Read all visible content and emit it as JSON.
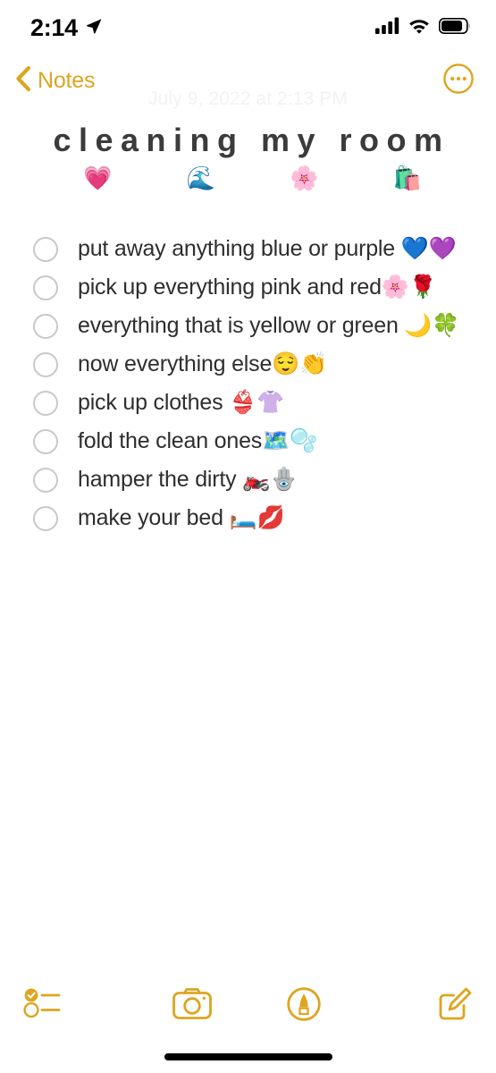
{
  "status_bar": {
    "time": "2:14",
    "location_icon": "location-arrow-icon",
    "signal_icon": "cellular-signal-icon",
    "signal_bars": 4,
    "wifi_icon": "wifi-icon",
    "battery_icon": "battery-icon",
    "battery_level": 78
  },
  "nav_bar": {
    "back_label": "Notes",
    "back_icon": "chevron-left-icon",
    "more_icon": "ellipsis-circle-icon",
    "accent_color": "#DDA520"
  },
  "note": {
    "date": "July 9, 2022 at 2:13 PM",
    "title": "cleaning my room",
    "emoji_row": "💗\t\t🌊\t\t🌸\t\t🛍️",
    "title_color": "#3b3b3b",
    "checklist": [
      {
        "text": "put away anything blue or purple 💙💜",
        "checked": false
      },
      {
        "text": "pick up everything pink and red🌸🌹",
        "checked": false
      },
      {
        "text": "everything that is yellow or green 🌙🍀",
        "checked": false
      },
      {
        "text": "now everything else😌👏",
        "checked": false
      },
      {
        "text": "pick up clothes 👙👚",
        "checked": false
      },
      {
        "text": "fold the clean ones🗺️🫧",
        "checked": false
      },
      {
        "text": "hamper the dirty 🏍️🪬",
        "checked": false
      },
      {
        "text": "make your bed 🛏️💋",
        "checked": false
      }
    ]
  },
  "toolbar": {
    "checklist_icon": "checklist-icon",
    "camera_icon": "camera-icon",
    "markup_icon": "markup-pen-icon",
    "compose_icon": "compose-icon",
    "accent_color": "#DDA520"
  }
}
